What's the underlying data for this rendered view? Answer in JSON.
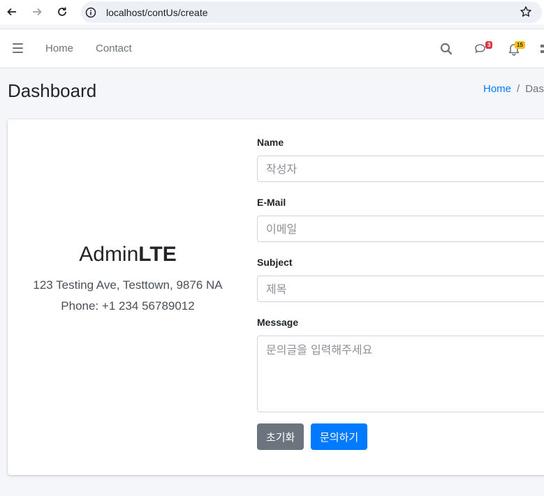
{
  "browser": {
    "url": "localhost/contUs/create"
  },
  "header": {
    "nav": [
      "Home",
      "Contact"
    ],
    "messages_count": "3",
    "notifications_count": "15"
  },
  "content_header": {
    "title": "Dashboard",
    "breadcrumb_home": "Home",
    "breadcrumb_sep": "/",
    "breadcrumb_current": "Das"
  },
  "company": {
    "brand_light": "Admin",
    "brand_bold": "LTE",
    "address": "123 Testing Ave, Testtown, 9876 NA",
    "phone": "Phone: +1 234 56789012"
  },
  "form": {
    "name_label": "Name",
    "name_placeholder": "작성자",
    "email_label": "E-Mail",
    "email_placeholder": "이메일",
    "subject_label": "Subject",
    "subject_placeholder": "제목",
    "message_label": "Message",
    "message_placeholder": "문의글을 입력해주세요",
    "reset_label": "초기화",
    "submit_label": "문의하기"
  }
}
